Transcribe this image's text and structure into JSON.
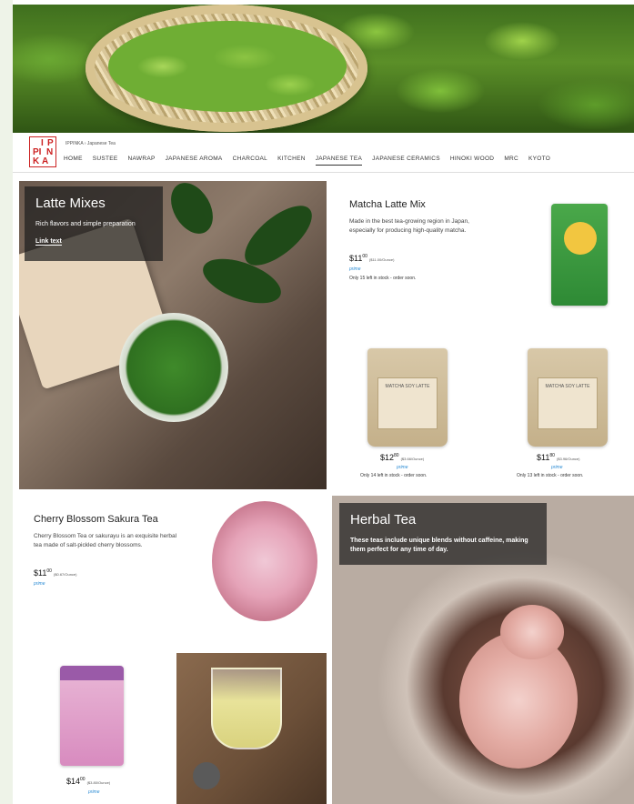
{
  "brand": {
    "logo_letters": [
      "I",
      "P",
      "PI",
      "N",
      "K",
      "A"
    ]
  },
  "breadcrumb": {
    "store": "IPPINKA",
    "sep": "›",
    "current": "Japanese Tea"
  },
  "nav": {
    "items": [
      "HOME",
      "SUSTEE",
      "NAWRAP",
      "JAPANESE AROMA",
      "CHARCOAL",
      "KITCHEN",
      "JAPANESE TEA",
      "JAPANESE CERAMICS",
      "HINOKI WOOD",
      "MRC",
      "KYOTO"
    ],
    "active": "JAPANESE TEA"
  },
  "latte_section": {
    "title": "Latte Mixes",
    "text": "Rich flavors and simple preparation",
    "link": "Link text"
  },
  "matcha": {
    "title": "Matcha Latte Mix",
    "desc": "Made in the best tea-growing region in Japan, especially for producing high-quality matcha.",
    "price_whole": "11",
    "price_cents": "00",
    "unit": "($11.00/Ounce)",
    "prime": "prime",
    "stock": "Only 15 left in stock - order soon."
  },
  "products_row": [
    {
      "price_whole": "12",
      "price_cents": "80",
      "unit": "($3.66/Ounce)",
      "prime": "prime",
      "stock": "Only 14 left in stock - order soon.",
      "label": "MATCHA SOY LATTE"
    },
    {
      "price_whole": "11",
      "price_cents": "80",
      "unit": "($3.96/Ounce)",
      "prime": "prime",
      "stock": "Only 13 left in stock - order soon.",
      "label": "MATCHA SOY LATTE"
    }
  ],
  "cherry": {
    "title": "Cherry Blossom Sakura Tea",
    "desc": "Cherry Blossom Tea or sakurayu is an exquisite herbal tea made of salt-pickled cherry blossoms.",
    "price_whole": "11",
    "price_cents": "00",
    "unit": "($0.67/Ounce)",
    "prime": "prime"
  },
  "herbal": {
    "title": "Herbal Tea",
    "text": "These teas include unique blends without caffeine, making them perfect for any time of day."
  },
  "konbu": {
    "price_whole": "14",
    "price_cents": "00",
    "unit": "($3.80/Ounce)",
    "prime": "prime"
  },
  "colors": {
    "accent": "#cc2222",
    "prime": "#2a8bd4",
    "overlay": "#1e1e1e"
  }
}
